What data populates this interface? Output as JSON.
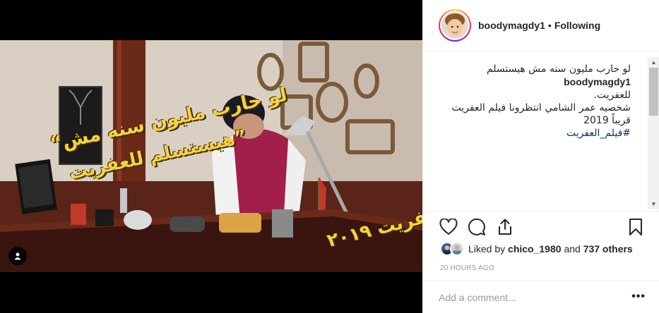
{
  "post": {
    "overlay": {
      "quote_line_1": "“لو حارب مليون سنه مش",
      "quote_line_2": "هيستسلم للعفريت”",
      "movie_title": "فيلم العفريت ٢٠١٩"
    }
  },
  "header": {
    "username": "boodymagdy1",
    "separator": "•",
    "follow_status": "Following"
  },
  "caption": {
    "username": "boodymagdy1",
    "line_1": "لو حارب مليون سنه مش هيستسلم",
    "line_2": "للعفريت.",
    "line_3": "شخصيه عمر الشامي انتظرونا فيلم العفريت قريباً 2019",
    "hashtag": "#فيلم_العفريت"
  },
  "actions": {
    "like_icon": "heart-icon",
    "comment_icon": "comment-icon",
    "share_icon": "share-icon",
    "save_icon": "bookmark-icon"
  },
  "likes": {
    "prefix": "Liked by",
    "user": "chico_1980",
    "middle": "and",
    "others": "737 others"
  },
  "timestamp": "20 HOURS AGO",
  "comment_box": {
    "placeholder": "Add a comment...",
    "more_label": "•••"
  },
  "colors": {
    "accent_blue": "#003569",
    "text": "#262626",
    "muted": "#999999",
    "overlay_yellow": "#f7d23a"
  }
}
